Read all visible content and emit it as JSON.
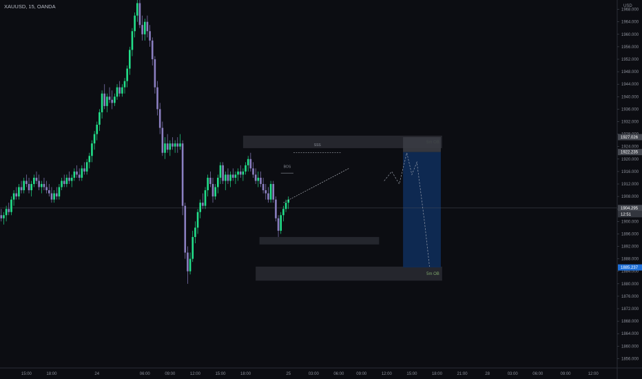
{
  "symbol_label": "XAUUSD, 15, OANDA",
  "currency": "USD",
  "colors": {
    "bull": "#22e08a",
    "bear": "#8b7fc1",
    "accent_blue": "#1f6fd6",
    "background": "#0c0d12"
  },
  "chart_data": {
    "type": "candlestick",
    "ylim": [
      1853,
      1971
    ],
    "yticks": [
      1856,
      1860,
      1864,
      1868,
      1872,
      1876,
      1880,
      1884,
      1888,
      1892,
      1896,
      1900,
      1904,
      1908,
      1912,
      1916,
      1920,
      1924,
      1928,
      1932,
      1936,
      1940,
      1944,
      1948,
      1952,
      1956,
      1960,
      1964,
      1968
    ],
    "ytick_labels": [
      "1856.000",
      "1860.000",
      "1864.000",
      "1868.000",
      "1872.000",
      "1876.000",
      "1880.000",
      "1884.000",
      "1888.000",
      "1892.000",
      "1896.000",
      "1900.000",
      "1904.000",
      "1908.000",
      "1912.000",
      "1916.000",
      "1920.000",
      "1924.000",
      "1928.000",
      "1932.000",
      "1936.000",
      "1940.000",
      "1944.000",
      "1948.000",
      "1952.000",
      "1956.000",
      "1960.000",
      "1964.000",
      "1968.000"
    ],
    "xlim": [
      0,
      245
    ],
    "xticks": [
      {
        "x": 10,
        "label": "15:00"
      },
      {
        "x": 20,
        "label": "18:00"
      },
      {
        "x": 38,
        "label": "24"
      },
      {
        "x": 57,
        "label": "06:00"
      },
      {
        "x": 67,
        "label": "09:00"
      },
      {
        "x": 77,
        "label": "12:00"
      },
      {
        "x": 87,
        "label": "15:00"
      },
      {
        "x": 97,
        "label": "18:00"
      },
      {
        "x": 114,
        "label": "25"
      },
      {
        "x": 124,
        "label": "03:00"
      },
      {
        "x": 134,
        "label": "06:00"
      },
      {
        "x": 143,
        "label": "09:00"
      },
      {
        "x": 153,
        "label": "12:00"
      },
      {
        "x": 163,
        "label": "15:00"
      },
      {
        "x": 173,
        "label": "18:00"
      },
      {
        "x": 183,
        "label": "21:00"
      },
      {
        "x": 193,
        "label": "28"
      },
      {
        "x": 203,
        "label": "03:00"
      },
      {
        "x": 213,
        "label": "06:00"
      },
      {
        "x": 224,
        "label": "09:00"
      },
      {
        "x": 235,
        "label": "12:00"
      }
    ],
    "candles": [
      [
        1902,
        1904,
        1900,
        1901
      ],
      [
        1901,
        1903,
        1899,
        1902
      ],
      [
        1902,
        1905,
        1900,
        1904
      ],
      [
        1904,
        1906,
        1902,
        1903
      ],
      [
        1903,
        1908,
        1902,
        1907
      ],
      [
        1907,
        1910,
        1905,
        1909
      ],
      [
        1909,
        1911,
        1907,
        1908
      ],
      [
        1908,
        1912,
        1907,
        1911
      ],
      [
        1911,
        1913,
        1909,
        1910
      ],
      [
        1910,
        1914,
        1909,
        1913
      ],
      [
        1913,
        1915,
        1911,
        1912
      ],
      [
        1912,
        1914,
        1909,
        1910
      ],
      [
        1910,
        1913,
        1908,
        1912
      ],
      [
        1912,
        1915,
        1911,
        1914
      ],
      [
        1914,
        1916,
        1912,
        1913
      ],
      [
        1913,
        1915,
        1910,
        1911
      ],
      [
        1911,
        1913,
        1909,
        1912
      ],
      [
        1912,
        1914,
        1910,
        1911
      ],
      [
        1911,
        1913,
        1909,
        1910
      ],
      [
        1910,
        1912,
        1908,
        1909
      ],
      [
        1909,
        1911,
        1906,
        1907
      ],
      [
        1907,
        1910,
        1906,
        1909
      ],
      [
        1909,
        1911,
        1907,
        1908
      ],
      [
        1908,
        1912,
        1907,
        1911
      ],
      [
        1911,
        1914,
        1910,
        1913
      ],
      [
        1913,
        1915,
        1911,
        1912
      ],
      [
        1912,
        1915,
        1911,
        1914
      ],
      [
        1914,
        1916,
        1912,
        1913
      ],
      [
        1913,
        1915,
        1911,
        1914
      ],
      [
        1914,
        1917,
        1913,
        1916
      ],
      [
        1916,
        1918,
        1914,
        1915
      ],
      [
        1915,
        1917,
        1913,
        1914
      ],
      [
        1914,
        1918,
        1913,
        1917
      ],
      [
        1917,
        1919,
        1915,
        1916
      ],
      [
        1916,
        1920,
        1915,
        1919
      ],
      [
        1919,
        1922,
        1917,
        1921
      ],
      [
        1921,
        1926,
        1919,
        1925
      ],
      [
        1925,
        1929,
        1923,
        1928
      ],
      [
        1928,
        1932,
        1926,
        1931
      ],
      [
        1931,
        1936,
        1929,
        1935
      ],
      [
        1935,
        1942,
        1933,
        1941
      ],
      [
        1941,
        1944,
        1936,
        1937
      ],
      [
        1937,
        1941,
        1935,
        1940
      ],
      [
        1940,
        1943,
        1938,
        1939
      ],
      [
        1939,
        1942,
        1936,
        1938
      ],
      [
        1938,
        1941,
        1937,
        1940
      ],
      [
        1940,
        1944,
        1939,
        1943
      ],
      [
        1943,
        1945,
        1940,
        1941
      ],
      [
        1941,
        1944,
        1940,
        1943
      ],
      [
        1943,
        1946,
        1941,
        1945
      ],
      [
        1945,
        1950,
        1943,
        1949
      ],
      [
        1949,
        1956,
        1947,
        1955
      ],
      [
        1955,
        1962,
        1953,
        1961
      ],
      [
        1961,
        1967,
        1959,
        1966
      ],
      [
        1966,
        1971,
        1964,
        1970
      ],
      [
        1970,
        1971,
        1962,
        1963
      ],
      [
        1963,
        1966,
        1958,
        1960
      ],
      [
        1960,
        1965,
        1958,
        1964
      ],
      [
        1964,
        1966,
        1959,
        1961
      ],
      [
        1961,
        1963,
        1956,
        1958
      ],
      [
        1958,
        1959,
        1950,
        1952
      ],
      [
        1952,
        1953,
        1941,
        1943
      ],
      [
        1943,
        1945,
        1934,
        1936
      ],
      [
        1936,
        1938,
        1928,
        1930
      ],
      [
        1930,
        1932,
        1921,
        1922
      ],
      [
        1922,
        1927,
        1920,
        1925
      ],
      [
        1925,
        1928,
        1922,
        1923
      ],
      [
        1923,
        1926,
        1921,
        1925
      ],
      [
        1925,
        1927,
        1923,
        1924
      ],
      [
        1924,
        1926,
        1922,
        1925
      ],
      [
        1925,
        1927,
        1922,
        1924
      ],
      [
        1924,
        1928,
        1923,
        1925
      ],
      [
        1925,
        1926,
        1902,
        1905
      ],
      [
        1905,
        1906,
        1888,
        1890
      ],
      [
        1890,
        1892,
        1880,
        1884
      ],
      [
        1884,
        1890,
        1883,
        1888
      ],
      [
        1888,
        1897,
        1887,
        1895
      ],
      [
        1895,
        1900,
        1893,
        1898
      ],
      [
        1898,
        1904,
        1896,
        1903
      ],
      [
        1903,
        1907,
        1901,
        1906
      ],
      [
        1906,
        1909,
        1904,
        1905
      ],
      [
        1905,
        1911,
        1904,
        1910
      ],
      [
        1910,
        1915,
        1908,
        1914
      ],
      [
        1914,
        1916,
        1911,
        1912
      ],
      [
        1912,
        1914,
        1906,
        1908
      ],
      [
        1908,
        1912,
        1907,
        1911
      ],
      [
        1911,
        1915,
        1909,
        1914
      ],
      [
        1914,
        1919,
        1912,
        1918
      ],
      [
        1918,
        1919,
        1912,
        1913
      ],
      [
        1913,
        1916,
        1910,
        1915
      ],
      [
        1915,
        1917,
        1912,
        1913
      ],
      [
        1913,
        1916,
        1911,
        1915
      ],
      [
        1915,
        1917,
        1913,
        1914
      ],
      [
        1914,
        1916,
        1912,
        1915
      ],
      [
        1915,
        1917,
        1913,
        1916
      ],
      [
        1916,
        1918,
        1914,
        1915
      ],
      [
        1915,
        1917,
        1913,
        1916
      ],
      [
        1916,
        1919,
        1915,
        1918
      ],
      [
        1918,
        1921,
        1916,
        1920
      ],
      [
        1920,
        1922,
        1916,
        1917
      ],
      [
        1917,
        1919,
        1914,
        1915
      ],
      [
        1915,
        1917,
        1912,
        1913
      ],
      [
        1913,
        1916,
        1911,
        1914
      ],
      [
        1914,
        1916,
        1911,
        1912
      ],
      [
        1912,
        1914,
        1909,
        1910
      ],
      [
        1910,
        1912,
        1907,
        1909
      ],
      [
        1909,
        1911,
        1906,
        1907
      ],
      [
        1907,
        1913,
        1906,
        1912
      ],
      [
        1912,
        1913,
        1906,
        1907
      ],
      [
        1907,
        1908,
        1900,
        1901
      ],
      [
        1901,
        1902,
        1895,
        1897
      ],
      [
        1897,
        1903,
        1896,
        1902
      ],
      [
        1902,
        1905,
        1900,
        1904
      ],
      [
        1904,
        1907,
        1903,
        1906
      ],
      [
        1906,
        1908,
        1904,
        1907
      ]
    ],
    "annotations": [
      {
        "label": "5m OB",
        "y_top": 1927.5,
        "y_bottom": 1923.5,
        "x_from": 96
      },
      {
        "label": "5m OB",
        "y_top": 1885.5,
        "y_bottom": 1881,
        "x_from": 101
      },
      {
        "label": "SSS"
      },
      {
        "label": "BOS"
      }
    ],
    "price_tags": [
      {
        "label": "1927.026",
        "y": 1927.026,
        "style": "gray"
      },
      {
        "label": "1922.235",
        "y": 1922.235,
        "style": "gray"
      },
      {
        "label": "1904.295",
        "y": 1904.295,
        "style": "gray"
      },
      {
        "label": "12:51",
        "y": 1902.3,
        "style": "gray-sub"
      },
      {
        "label": "1885.237",
        "y": 1885.237,
        "style": "blue"
      }
    ],
    "current_price": 1904.295,
    "short_position": {
      "entry": 1922.235,
      "stop": 1927.026,
      "target": 1885.237
    },
    "projection_path": [
      [
        152,
        1913
      ],
      [
        155,
        1916
      ],
      [
        158,
        1912
      ],
      [
        161,
        1922
      ],
      [
        163,
        1915
      ],
      [
        165,
        1919
      ],
      [
        168,
        1900
      ],
      [
        170,
        1885.5
      ]
    ]
  }
}
